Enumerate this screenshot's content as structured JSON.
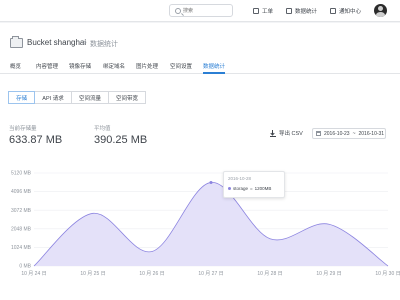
{
  "topbar": {
    "search_placeholder": "搜索",
    "nav": [
      {
        "label": "工单",
        "icon": "ticket-icon"
      },
      {
        "label": "数据统计",
        "icon": "stats-icon"
      },
      {
        "label": "通知中心",
        "icon": "mail-icon"
      }
    ]
  },
  "header": {
    "title": "Bucket shanghai",
    "separator": ">",
    "breadcrumb": "数据统计"
  },
  "tabs": [
    "概览",
    "内容管理",
    "镜像存储",
    "绑定域名",
    "图片处理",
    "空间设置",
    "数据统计"
  ],
  "active_tab": "数据统计",
  "subtabs": [
    "存储",
    "API 请求",
    "空间流量",
    "空间带宽"
  ],
  "active_subtab": "存储",
  "stats": {
    "current_label": "当前存储量",
    "current_value": "633.87 MB",
    "avg_label": "平均值",
    "avg_value": "390.25 MB"
  },
  "export_label": "导出 CSV",
  "date_range": {
    "from": "2016-10-23",
    "sep": "~",
    "to": "2016-10-31"
  },
  "tooltip": {
    "date": "2016-10-28",
    "series": "storage",
    "value": "1200MB"
  },
  "colors": {
    "accent": "#2b7fd4",
    "area_fill": "#e4e1f9",
    "area_stroke": "#8c84e0"
  },
  "chart_data": {
    "type": "area",
    "x": [
      "10 月 24 日",
      "10 月 25 日",
      "10 月 26 日",
      "10 月 27 日",
      "10 月 28 日",
      "10 月 29 日",
      "10 月 30 日"
    ],
    "y_ticks": [
      "0 MB",
      "1024 MB",
      "2048 MB",
      "3072 MB",
      "4096 MB",
      "5120 MB"
    ],
    "ylim": [
      0,
      5120
    ],
    "series": [
      {
        "values": [
          0,
          2900,
          800,
          4600,
          1500,
          2300,
          0
        ]
      }
    ],
    "grid": true
  }
}
